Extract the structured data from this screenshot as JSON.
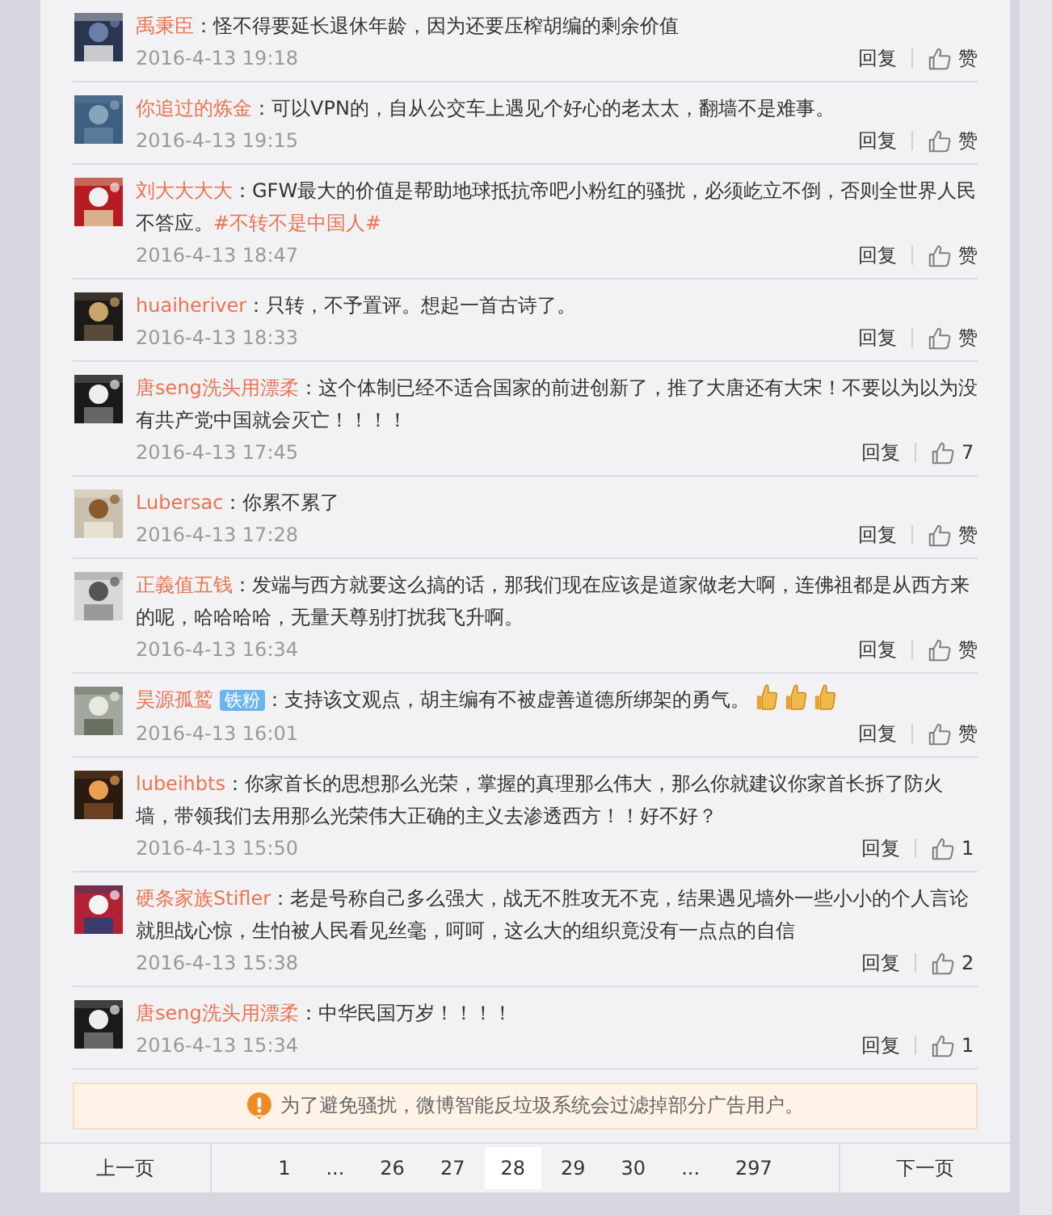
{
  "comments": [
    {
      "user": "禹秉臣",
      "text": "：怪不得要延长退休年龄，因为还要压榨胡编的剩余价值",
      "time": "2016-4-13 19:18",
      "reply": "回复",
      "likes": "赞"
    },
    {
      "user": "你追过的炼金",
      "text": "：可以VPN的，自从公交车上遇见个好心的老太太，翻墙不是难事。",
      "time": "2016-4-13 19:15",
      "reply": "回复",
      "likes": "赞"
    },
    {
      "user": "刘大大大大",
      "text": "：GFW最大的价值是帮助地球抵抗帝吧小粉红的骚扰，必须屹立不倒，否则全世界人民不答应。",
      "hashtag": "#不转不是中国人#",
      "time": "2016-4-13 18:47",
      "reply": "回复",
      "likes": "赞"
    },
    {
      "user": "huaiheriver",
      "text": "：只转，不予置评。想起一首古诗了。",
      "time": "2016-4-13 18:33",
      "reply": "回复",
      "likes": "赞"
    },
    {
      "user": "唐seng洗头用漂柔",
      "text": "：这个体制已经不适合国家的前进创新了，推了大唐还有大宋！不要以为以为没有共产党中国就会灭亡！！！！",
      "time": "2016-4-13 17:45",
      "reply": "回复",
      "likes": "7"
    },
    {
      "user": "Lubersac",
      "text": "：你累不累了",
      "time": "2016-4-13 17:28",
      "reply": "回复",
      "likes": "赞"
    },
    {
      "user": "正義值五钱",
      "text": "：发端与西方就要这么搞的话，那我们现在应该是道家做老大啊，连佛祖都是从西方来的呢，哈哈哈哈，无量天尊别打扰我飞升啊。",
      "time": "2016-4-13 16:34",
      "reply": "回复",
      "likes": "赞"
    },
    {
      "user": "昊源孤鹫",
      "badge": "铁粉",
      "text": "：支持该文观点，胡主编有不被虚善道德所绑架的勇气。",
      "emojis": [
        {
          "kind": "thumbs_up"
        },
        {
          "kind": "thumbs_up"
        },
        {
          "kind": "thumbs_up"
        }
      ],
      "time": "2016-4-13 16:01",
      "reply": "回复",
      "likes": "赞"
    },
    {
      "user": "lubeihbts",
      "text": "：你家首长的思想那么光荣，掌握的真理那么伟大，那么你就建议你家首长拆了防火墙，带领我们去用那么光荣伟大正确的主义去渗透西方！！好不好？",
      "time": "2016-4-13 15:50",
      "reply": "回复",
      "likes": "1"
    },
    {
      "user": "硬条家族Stifler",
      "text": "：老是号称自己多么强大，战无不胜攻无不克，结果遇见墙外一些小小的个人言论就胆战心惊，生怕被人民看见丝毫，呵呵，这么大的组织竟没有一点点的自信",
      "time": "2016-4-13 15:38",
      "reply": "回复",
      "likes": "2"
    },
    {
      "user": "唐seng洗头用漂柔",
      "text": "：中华民国万岁！！！！",
      "time": "2016-4-13 15:34",
      "reply": "回复",
      "likes": "1"
    }
  ],
  "notice": "为了避免骚扰，微博智能反垃圾系统会过滤掉部分广告用户。",
  "pagination": {
    "prev": "上一页",
    "next": "下一页",
    "pages": [
      {
        "label": "1",
        "selected": false
      },
      {
        "label": "...",
        "selected": false
      },
      {
        "label": "26",
        "selected": false
      },
      {
        "label": "27",
        "selected": false
      },
      {
        "label": "28",
        "selected": true
      },
      {
        "label": "29",
        "selected": false
      },
      {
        "label": "30",
        "selected": false
      },
      {
        "label": "...",
        "selected": false
      },
      {
        "label": "297",
        "selected": false
      }
    ]
  }
}
